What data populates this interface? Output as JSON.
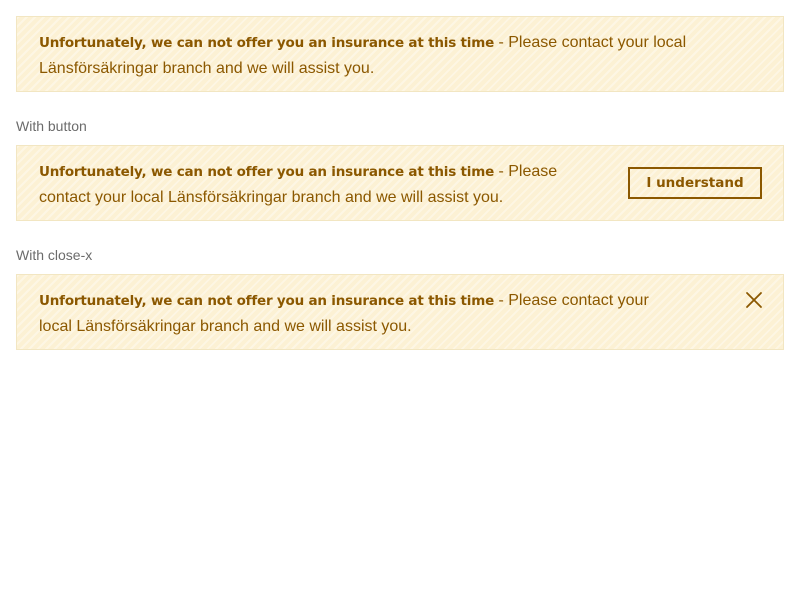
{
  "alerts": [
    {
      "bold": "Unfortunately, we can not offer you an insurance at this time",
      "text": " - Please contact your local Länsförsäkringar branch and we will assist you."
    },
    {
      "label": "With button",
      "bold": "Unfortunately, we can not offer you an insurance at this time",
      "text": " - Please contact your local Länsförsäkringar branch and we will assist you.",
      "button_label": "I understand"
    },
    {
      "label": "With close-x",
      "bold": "Unfortunately, we can not offer you an insurance at this time",
      "text": " - Please contact your local Länsförsäkringar branch and we will assist you.",
      "close_icon": "close-icon"
    }
  ],
  "colors": {
    "alert_background": "#fcf1d4",
    "alert_border": "#f2e6c2",
    "alert_text": "#8b5800",
    "label_text": "#6b6b6b"
  }
}
